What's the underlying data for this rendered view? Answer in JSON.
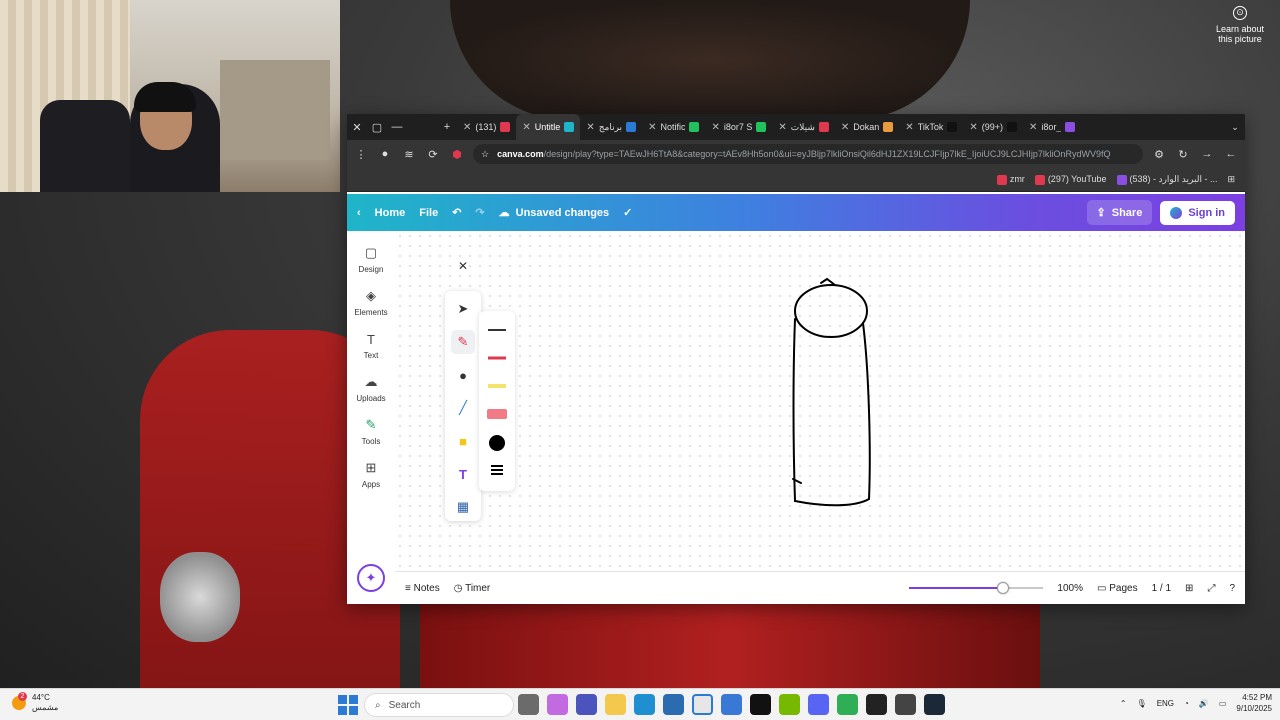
{
  "desktop": {
    "learn_about": "Learn about this picture"
  },
  "browser": {
    "tabs": [
      {
        "title": "(131)",
        "color": "#e0394f"
      },
      {
        "title": "Untitle",
        "color": "#1fb5c9",
        "active": true
      },
      {
        "title": "برنامج",
        "color": "#2b7bd6"
      },
      {
        "title": "Notific",
        "color": "#21c25e"
      },
      {
        "title": "i8or7 S",
        "color": "#21c25e"
      },
      {
        "title": "شيلات",
        "color": "#e0394f"
      },
      {
        "title": "Dokan",
        "color": "#e89a3c"
      },
      {
        "title": "TikTok",
        "color": "#111111"
      },
      {
        "title": "(99+)",
        "color": "#111111"
      },
      {
        "title": "i8or_",
        "color": "#8a4fe0"
      }
    ],
    "url_host": "canva.com",
    "url_path": "/design/play?type=TAEwJH6TtA8&category=tAEv8Hh5on0&ui=eyJBljp7lkliOnsiQil6dHJ1ZX19LCJFIjp7lkE_IjoiUCJ9LCJHIjp7lkliOnRydWV9fQ",
    "bookmarks": [
      {
        "label": "zmr",
        "color": "#e0394f"
      },
      {
        "label": "(297) YouTube",
        "color": "#e0394f"
      },
      {
        "label": "(538) - البريد الوارد - ...",
        "color": "#8a4fe0"
      }
    ]
  },
  "canva": {
    "home": "Home",
    "file": "File",
    "unsaved": "Unsaved changes",
    "share": "Share",
    "sign_in": "Sign in",
    "rail": [
      {
        "label": "Design",
        "icon": "design-icon",
        "glyph": "▢"
      },
      {
        "label": "Elements",
        "icon": "elements-icon",
        "glyph": "◈"
      },
      {
        "label": "Text",
        "icon": "text-icon",
        "glyph": "T"
      },
      {
        "label": "Uploads",
        "icon": "upload-icon",
        "glyph": "☁"
      },
      {
        "label": "Tools",
        "icon": "tools-icon",
        "glyph": "✎",
        "active": true
      },
      {
        "label": "Apps",
        "icon": "apps-icon",
        "glyph": "⊞"
      }
    ],
    "notes": "Notes",
    "timer": "Timer",
    "zoom": "100%",
    "zoom_level": 0.7,
    "pages": "Pages",
    "page_count": "1 / 1"
  },
  "taskbar": {
    "temp": "44°C",
    "weather_text": "مشمس",
    "weather_badge": "2",
    "search": "Search",
    "lang": "ENG",
    "time": "4:52 PM",
    "date": "9/10/2025"
  }
}
